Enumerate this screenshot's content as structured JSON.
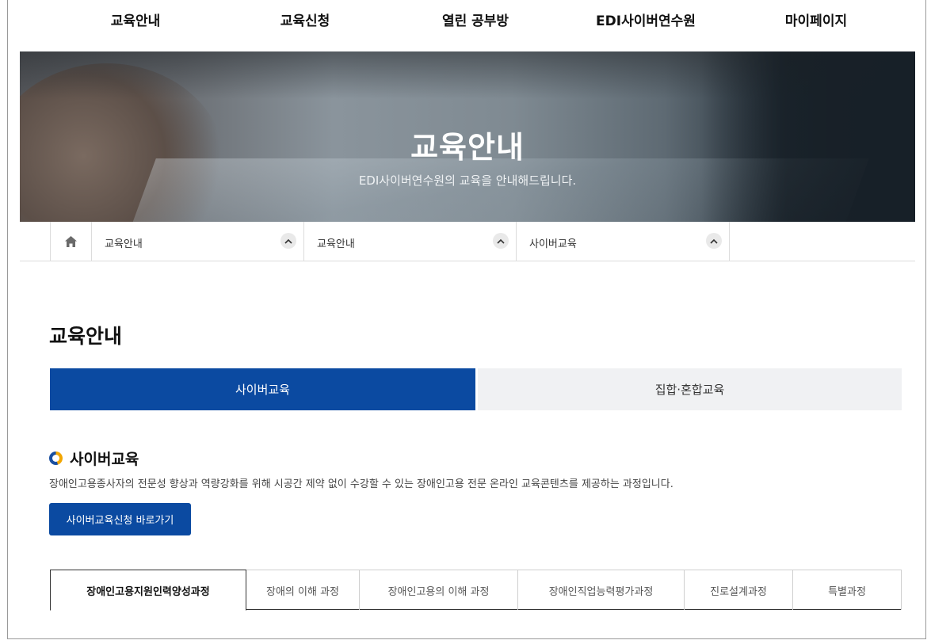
{
  "gnb": {
    "items": [
      {
        "label": "교육안내"
      },
      {
        "label": "교육신청"
      },
      {
        "label": "열린 공부방"
      },
      {
        "label": "EDI사이버연수원"
      },
      {
        "label": "마이페이지"
      }
    ]
  },
  "hero": {
    "title": "교육안내",
    "subtitle": "EDI사이버연수원의 교육을 안내해드립니다."
  },
  "breadcrumb": {
    "home_icon": "home-icon",
    "items": [
      {
        "label": "교육안내",
        "icon": "chevron-up-icon"
      },
      {
        "label": "교육안내",
        "icon": "chevron-up-icon"
      },
      {
        "label": "사이버교육",
        "icon": "chevron-up-icon"
      }
    ]
  },
  "page": {
    "title": "교육안내"
  },
  "main_tabs": [
    {
      "label": "사이버교육",
      "active": true
    },
    {
      "label": "집합·혼합교육",
      "active": false
    }
  ],
  "section": {
    "title": "사이버교육",
    "description": "장애인고용종사자의 전문성 향상과 역량강화를 위해 시공간 제약 없이 수강할 수 있는 장애인고용 전문 온라인 교육콘텐츠를 제공하는 과정입니다.",
    "apply_button": "사이버교육신청 바로가기"
  },
  "course_tabs": [
    {
      "label": "장애인고용지원인력양성과정",
      "active": true
    },
    {
      "label": "장애의 이해 과정",
      "active": false
    },
    {
      "label": "장애인고용의 이해 과정",
      "active": false
    },
    {
      "label": "장애인직업능력평가과정",
      "active": false
    },
    {
      "label": "진로설계과정",
      "active": false
    },
    {
      "label": "특별과정",
      "active": false
    }
  ],
  "colors": {
    "primary": "#0b4aa1",
    "tab_inactive_bg": "#f0f1f3",
    "border": "#dcdcdc"
  }
}
